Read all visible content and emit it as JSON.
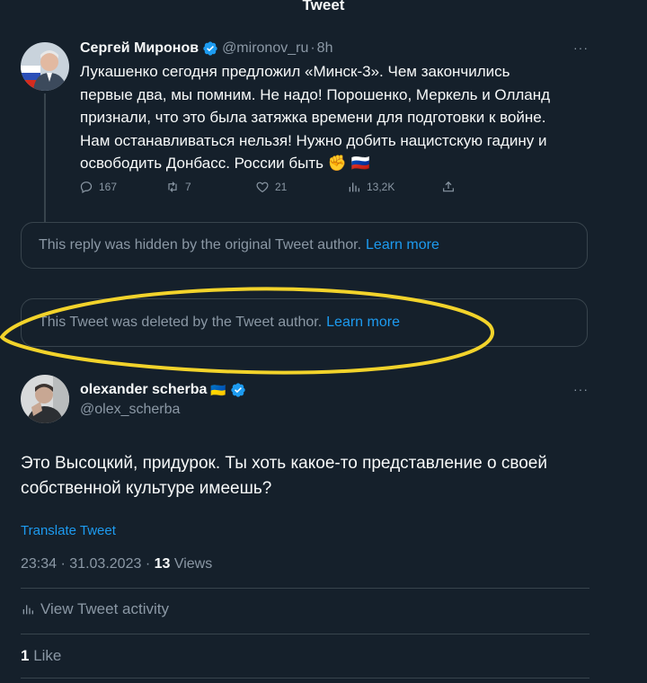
{
  "header": {
    "title": "Tweet"
  },
  "parent_tweet": {
    "author_name": "Сергей Миронов",
    "handle": "@mironov_ru",
    "separator": "·",
    "time": "8h",
    "more": "···",
    "text_lines": [
      "Лукашенко сегодня предложил «Минск-3». Чем закончились",
      "первые два, мы помним. Не надо! Порошенко, Меркель и Олланд",
      "признали, что это была затяжка времени для подготовки к войне.",
      "Нам останавливаться нельзя! Нужно добить нацистскую гадину и",
      "освободить Донбасс. России быть ✊ 🇷🇺"
    ],
    "replies": "167",
    "retweets": "7",
    "likes": "21",
    "views": "13,2K"
  },
  "notices": {
    "hidden_text": "This reply was hidden by the original Tweet author.",
    "hidden_link": "Learn more",
    "deleted_text": "This Tweet was deleted by the Tweet author.",
    "deleted_link": "Learn more"
  },
  "main_tweet": {
    "author_name": "olexander scherba",
    "flag": "🇺🇦",
    "handle": "@olex_scherba",
    "more": "···",
    "text_lines": [
      "Это Высоцкий, придурок. Ты хоть какое-то представление о своей",
      "собственной культуре имеешь?"
    ],
    "translate": "Translate Tweet",
    "time": "23:34",
    "date": "31.03.2023",
    "separator": "·",
    "views_count": "13",
    "views_label": "Views",
    "activity": "View Tweet activity",
    "like_count": "1",
    "like_label": "Like"
  },
  "colors": {
    "background": "#15202b",
    "text": "#f7f9f9",
    "secondary": "#8b98a5",
    "accent": "#1d9bf0",
    "border": "#38444d",
    "highlight": "#f2d32b"
  }
}
